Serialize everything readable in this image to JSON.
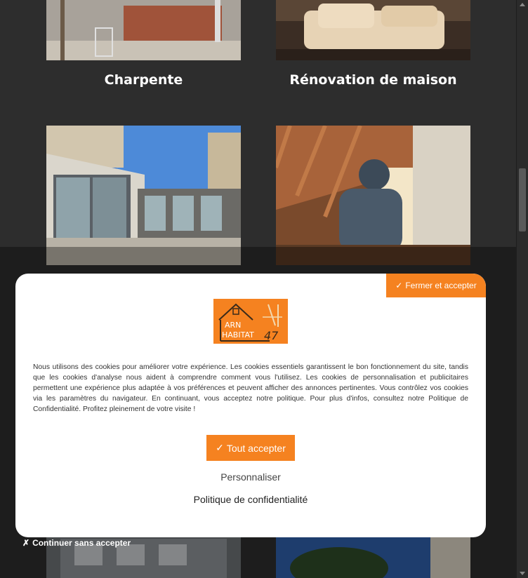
{
  "cards": [
    {
      "title": "Charpente"
    },
    {
      "title": "Rénovation de maison"
    }
  ],
  "modal": {
    "close_accept_icon": "✓",
    "close_accept_label": "Fermer et accepter",
    "logo": {
      "line1": "ARN",
      "line2": "HABITAT",
      "number": "47"
    },
    "consent_text": "Nous utilisons des cookies pour améliorer votre expérience. Les cookies essentiels garantissent le bon fonctionnement du site, tandis que les cookies d'analyse nous aident à comprendre comment vous l'utilisez. Les cookies de personnalisation et publicitaires permettent une expérience plus adaptée à vos préférences et peuvent afficher des annonces pertinentes. Vous contrôlez vos cookies via les paramètres du navigateur. En continuant, vous acceptez notre politique. Pour plus d'infos, consultez notre Politique de Confidentialité. Profitez pleinement de votre visite !",
    "accept_all_icon": "✓",
    "accept_all_label": "Tout accepter",
    "customize_label": "Personnaliser",
    "privacy_label": "Politique de confidentialité"
  },
  "continue_without": {
    "icon": "✗",
    "label": "Continuer sans accepter"
  },
  "colors": {
    "accent": "#f58220",
    "background": "#2d2d2d"
  }
}
